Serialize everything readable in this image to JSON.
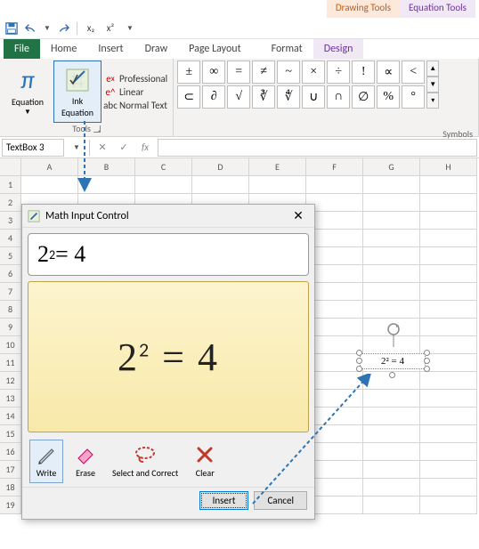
{
  "qat": {
    "save": "save-icon",
    "undo": "undo-icon",
    "redo": "redo-icon",
    "sub": "x₂",
    "sup": "x²"
  },
  "context_tabs": {
    "drawing": "Drawing Tools",
    "equation": "Equation Tools"
  },
  "tabs": {
    "file": "File",
    "home": "Home",
    "insert": "Insert",
    "draw": "Draw",
    "page_layout": "Page Layout",
    "format": "Format",
    "design": "Design"
  },
  "ribbon": {
    "tools_group": "Tools",
    "equation_btn": "Equation",
    "ink_btn_l1": "Ink",
    "ink_btn_l2": "Equation",
    "conversions": {
      "professional": "Professional",
      "linear": "Linear",
      "normal": "Normal Text"
    },
    "symbols_label": "Symbols",
    "symbols_row1": [
      "±",
      "∞",
      "=",
      "≠",
      "~",
      "×",
      "÷",
      "!",
      "∝",
      "<"
    ],
    "symbols_row2": [
      "⊂",
      "∂",
      "√",
      "∛",
      "∜",
      "∪",
      "∩",
      "∅",
      "%",
      "°"
    ]
  },
  "namebox": {
    "value": "TextBox 3",
    "fx": "fx"
  },
  "columns": [
    "A",
    "B",
    "C",
    "D",
    "E",
    "F",
    "G",
    "H"
  ],
  "rows": [
    "1",
    "2",
    "3",
    "4",
    "5",
    "6",
    "7",
    "8",
    "9",
    "10",
    "11",
    "12",
    "13",
    "14",
    "15",
    "16",
    "17",
    "18",
    "19"
  ],
  "dialog": {
    "title": "Math Input Control",
    "preview_html": "2<sup>2</sup> = 4",
    "ink_html": "2<sup>2</sup> = 4",
    "tools": {
      "write": "Write",
      "erase": "Erase",
      "select": "Select and Correct",
      "clear": "Clear"
    },
    "insert": "Insert",
    "cancel": "Cancel"
  },
  "sheet_eq": "2² = 4"
}
